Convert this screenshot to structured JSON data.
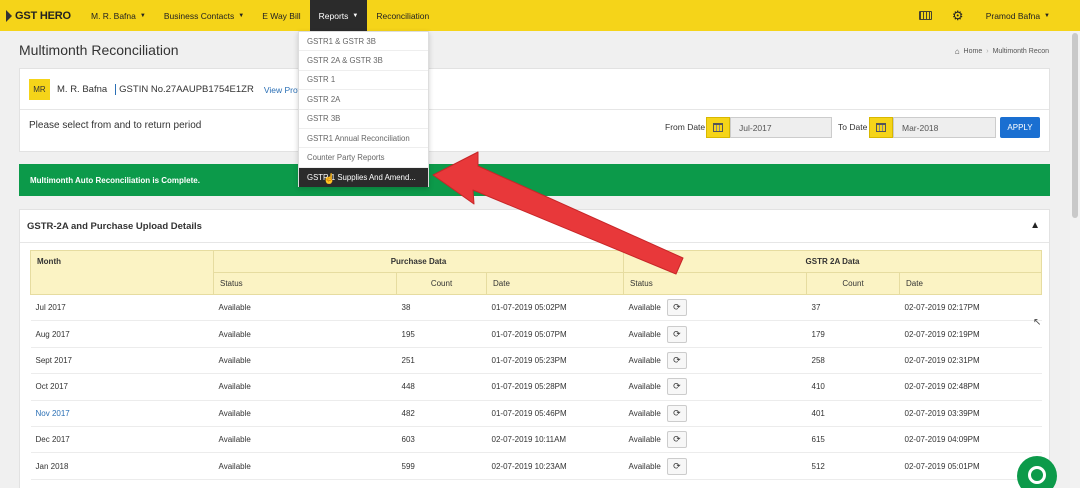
{
  "nav": {
    "brand": "GST HERO",
    "items": [
      {
        "label": "M. R. Bafna",
        "caret": true
      },
      {
        "label": "Business Contacts",
        "caret": true
      },
      {
        "label": "E Way Bill",
        "caret": false
      },
      {
        "label": "Reports",
        "caret": true
      },
      {
        "label": "Reconciliation",
        "caret": false
      }
    ],
    "user": "Pramod Bafna"
  },
  "page": {
    "title": "Multimonth Reconciliation",
    "breadcrumb": [
      "Home",
      "Multimonth Recon"
    ]
  },
  "company": {
    "initials": "MR",
    "name": "M. R. Bafna",
    "gstin": "GSTIN No.27AAUPB1754E1ZR",
    "view_profile": "View Profi"
  },
  "period": {
    "prompt": "Please select from and to return period",
    "from_label": "From Date",
    "from_value": "Jul-2017",
    "to_label": "To Date",
    "to_value": "Mar-2018",
    "apply": "APPLY"
  },
  "banner": "Multimonth Auto Reconciliation is Complete.",
  "details": {
    "title": "GSTR-2A and Purchase Upload Details",
    "headers": {
      "month": "Month",
      "purchase": "Purchase Data",
      "gstr2a": "GSTR 2A Data",
      "status": "Status",
      "count": "Count",
      "date": "Date"
    },
    "rows": [
      {
        "month": "Jul 2017",
        "p_status": "Available",
        "p_count": "38",
        "p_date": "01-07-2019 05:02PM",
        "g_status": "Available",
        "g_count": "37",
        "g_date": "02-07-2019 02:17PM"
      },
      {
        "month": "Aug 2017",
        "p_status": "Available",
        "p_count": "195",
        "p_date": "01-07-2019 05:07PM",
        "g_status": "Available",
        "g_count": "179",
        "g_date": "02-07-2019 02:19PM"
      },
      {
        "month": "Sept 2017",
        "p_status": "Available",
        "p_count": "251",
        "p_date": "01-07-2019 05:23PM",
        "g_status": "Available",
        "g_count": "258",
        "g_date": "02-07-2019 02:31PM"
      },
      {
        "month": "Oct 2017",
        "p_status": "Available",
        "p_count": "448",
        "p_date": "01-07-2019 05:28PM",
        "g_status": "Available",
        "g_count": "410",
        "g_date": "02-07-2019 02:48PM"
      },
      {
        "month": "Nov 2017",
        "p_status": "Available",
        "p_count": "482",
        "p_date": "01-07-2019 05:46PM",
        "g_status": "Available",
        "g_count": "401",
        "g_date": "02-07-2019 03:39PM"
      },
      {
        "month": "Dec 2017",
        "p_status": "Available",
        "p_count": "603",
        "p_date": "02-07-2019 10:11AM",
        "g_status": "Available",
        "g_count": "615",
        "g_date": "02-07-2019 04:09PM"
      },
      {
        "month": "Jan 2018",
        "p_status": "Available",
        "p_count": "599",
        "p_date": "02-07-2019 10:23AM",
        "g_status": "Available",
        "g_count": "512",
        "g_date": "02-07-2019 05:01PM"
      }
    ]
  },
  "reports_menu": [
    "GSTR1 & GSTR 3B",
    "GSTR 2A & GSTR 3B",
    "GSTR 1",
    "GSTR 2A",
    "GSTR 3B",
    "GSTR1 Annual Reconciliation",
    "Counter Party Reports",
    "GSTR 1 Supplies And Amend..."
  ],
  "colors": {
    "nav_bg": "#f5d419",
    "active_bg": "#2b2b2b",
    "success": "#0c9a4a",
    "primary": "#1a6fd1",
    "arrow": "#e8383a"
  }
}
